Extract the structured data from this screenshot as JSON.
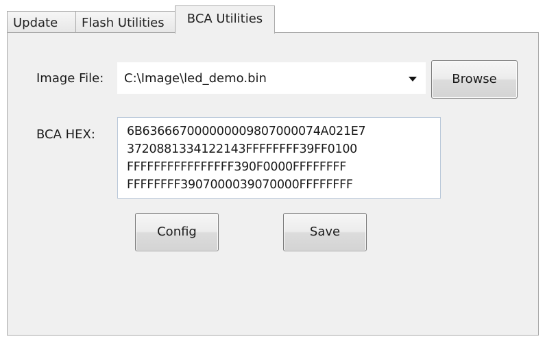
{
  "tabs": [
    {
      "label": "Update",
      "active": false
    },
    {
      "label": "Flash Utilities",
      "active": false
    },
    {
      "label": "BCA Utilities",
      "active": true
    }
  ],
  "image_file": {
    "label": "Image File:",
    "value": "C:\\Image\\led_demo.bin"
  },
  "browse_label": "Browse",
  "bca_hex": {
    "label": "BCA HEX:",
    "lines": [
      "6B636667000000009807000074A021E7",
      "372088133412214 3FFFFFFFF39FF0100",
      "FFFFFFFFFFFFFFFF390F0000FFFFFFFF",
      "FFFFFFFF3907000039070000FFFFFFFF"
    ]
  },
  "buttons": {
    "config_label": "Config",
    "save_label": "Save"
  }
}
